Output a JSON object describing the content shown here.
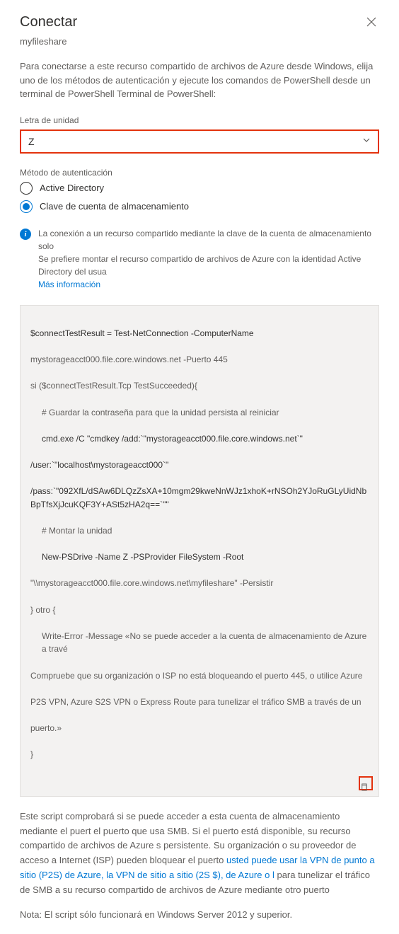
{
  "header": {
    "title": "Conectar",
    "subtitle": "myfileshare"
  },
  "description": "Para conectarse a este recurso compartido de archivos de Azure desde Windows, elija uno de los métodos de autenticación y ejecute los comandos de PowerShell desde un terminal de PowerShell Terminal de PowerShell:",
  "drive": {
    "label": "Letra de unidad",
    "value": "Z"
  },
  "auth": {
    "label": "Método de autenticación",
    "options": [
      {
        "label": "Active Directory",
        "selected": false
      },
      {
        "label": "Clave de cuenta de almacenamiento",
        "selected": true
      }
    ]
  },
  "info": {
    "text1": "La conexión a un recurso compartido mediante la clave de la cuenta de almacenamiento solo",
    "text2": "Se prefiere montar el recurso compartido de archivos de Azure con la identidad Active Directory del usua",
    "link": "Más información"
  },
  "code": {
    "l1": "$connectTestResult = Test-NetConnection -ComputerName",
    "l2": "mystorageacct000.file.core.windows.net -Puerto 445",
    "l3": "si ($connectTestResult.Tcp TestSucceeded){",
    "l4": "# Guardar la contraseña para que la unidad persista al reiniciar",
    "l5a": "cmd.exe /C \"cmdkey /add:`\"mystorageacct000.file.core.windows.net`\"",
    "l5b": "/user:`\"localhost\\mystorageacct000`\"",
    "l5c": "/pass:`\"092XfL/dSAw6DLQzZsXA+10mgm29kweNnWJz1xhoK+rNSOh2YJoRuGLyUidNbBpTfsXjJcuKQF3Y+ASt5zHA2q==`\"\"",
    "l6": "# Montar la unidad",
    "l7": "New-PSDrive -Name Z -PSProvider FileSystem -Root",
    "l8": "\"\\\\mystorageacct000.file.core.windows.net\\myfileshare\" -Persistir",
    "l9": "} otro {",
    "l10": "Write-Error -Message «No se puede acceder a la cuenta de almacenamiento de Azure a travé",
    "l11": "Compruebe que su organización o ISP no está bloqueando el puerto 445, o utilice Azure",
    "l12": "P2S VPN, Azure S2S VPN o Express Route para tunelizar el tráfico SMB a través de un",
    "l13": "puerto.»",
    "l14": "}"
  },
  "footer": {
    "p1a": "Este script comprobará si se puede acceder a esta cuenta de almacenamiento mediante el puert",
    "p1b": "el puerto que usa SMB. Si el puerto está disponible, su recurso compartido de archivos de Azure s",
    "p1c": "persistente. Su organización o su proveedor de acceso a Internet (ISP) pueden bloquear el puerto",
    "link": "usted puede usar la VPN de punto a sitio (P2S) de Azure, la VPN de sitio a sitio (2S $), de Azure o l",
    "p1d": "para tunelizar el tráfico de SMB a su recurso compartido de archivos de Azure mediante otro puerto",
    "note": "Nota: El script sólo funcionará en Windows Server 2012 y superior."
  }
}
